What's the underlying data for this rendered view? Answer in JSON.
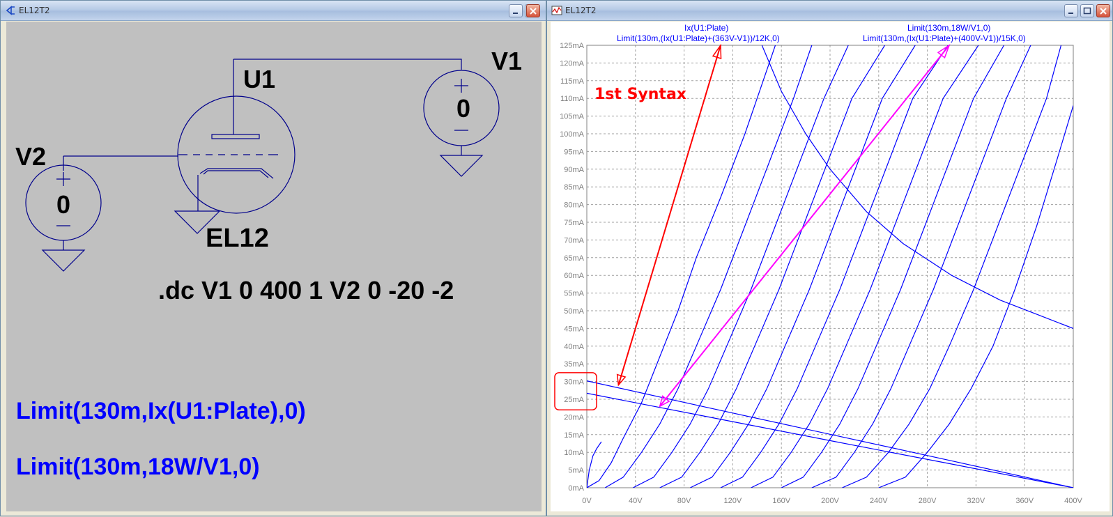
{
  "schematic_window": {
    "title": "EL12T2",
    "labels": {
      "v1": "V1",
      "v2": "V2",
      "u1": "U1",
      "tube_model": "EL12",
      "v1_value": "0",
      "v2_value": "0",
      "plus": "+",
      "minus": "−"
    },
    "dc_directive": ".dc V1 0 400 1 V2 0 -20 -2",
    "expressions": [
      "Limit(130m,Ix(U1:Plate),0)",
      "Limit(130m,18W/V1,0)"
    ]
  },
  "plot_window": {
    "title": "EL12T2",
    "annotation": "1st Syntax",
    "trace_titles": {
      "left_line1": "Ix(U1:Plate)",
      "left_line2": "Limit(130m,(Ix(U1:Plate)+(363V-V1))/12K,0)",
      "right_line1": "Limit(130m,18W/V1,0)",
      "right_line2": "Limit(130m,(Ix(U1:Plate)+(400V-V1))/15K,0)"
    },
    "colors": {
      "trace": "#0000ff",
      "annotation": "#ff0000",
      "highlight": "#ff00ff",
      "grid": "#a0a0a0",
      "axis_text": "#808080"
    }
  },
  "chart_data": {
    "type": "line",
    "xlabel": "",
    "ylabel": "",
    "xlim": [
      0,
      400
    ],
    "ylim": [
      0,
      125
    ],
    "x_ticks": [
      "0V",
      "40V",
      "80V",
      "120V",
      "160V",
      "200V",
      "240V",
      "280V",
      "320V",
      "360V",
      "400V"
    ],
    "y_ticks": [
      "0mA",
      "5mA",
      "10mA",
      "15mA",
      "20mA",
      "25mA",
      "30mA",
      "35mA",
      "40mA",
      "45mA",
      "50mA",
      "55mA",
      "60mA",
      "65mA",
      "70mA",
      "75mA",
      "80mA",
      "85mA",
      "90mA",
      "95mA",
      "100mA",
      "105mA",
      "110mA",
      "115mA",
      "120mA",
      "125mA"
    ],
    "grid": true,
    "series": [
      {
        "x": [
          0,
          2,
          5,
          8,
          12
        ],
        "y": [
          0,
          5,
          9,
          11,
          13
        ]
      },
      {
        "x": [
          0,
          10,
          20,
          30,
          45,
          60,
          75,
          90,
          110,
          130,
          155
        ],
        "y": [
          0,
          2,
          7,
          14,
          24,
          37,
          50,
          65,
          82,
          100,
          125
        ]
      },
      {
        "x": [
          15,
          30,
          45,
          60,
          75,
          90,
          110,
          130,
          150,
          170,
          185
        ],
        "y": [
          0,
          3,
          10,
          18,
          28,
          40,
          56,
          74,
          92,
          110,
          125
        ]
      },
      {
        "x": [
          38,
          55,
          70,
          85,
          100,
          115,
          135,
          155,
          175,
          195,
          215
        ],
        "y": [
          0,
          3,
          10,
          18,
          28,
          40,
          56,
          74,
          92,
          110,
          125
        ]
      },
      {
        "x": [
          60,
          78,
          93,
          108,
          123,
          138,
          158,
          178,
          198,
          218,
          245
        ],
        "y": [
          0,
          3,
          10,
          18,
          28,
          40,
          56,
          74,
          92,
          110,
          125
        ]
      },
      {
        "x": [
          85,
          103,
          118,
          133,
          148,
          163,
          183,
          203,
          223,
          243,
          270
        ],
        "y": [
          0,
          3,
          10,
          18,
          28,
          40,
          56,
          74,
          92,
          110,
          125
        ]
      },
      {
        "x": [
          110,
          128,
          143,
          158,
          173,
          188,
          208,
          228,
          248,
          268,
          297
        ],
        "y": [
          0,
          3,
          10,
          18,
          28,
          40,
          56,
          74,
          92,
          110,
          125
        ]
      },
      {
        "x": [
          135,
          153,
          168,
          183,
          198,
          213,
          233,
          253,
          273,
          293,
          322
        ],
        "y": [
          0,
          3,
          10,
          18,
          28,
          40,
          56,
          74,
          92,
          110,
          125
        ]
      },
      {
        "x": [
          160,
          178,
          193,
          208,
          223,
          238,
          258,
          278,
          298,
          318,
          343
        ],
        "y": [
          0,
          3,
          10,
          18,
          28,
          40,
          56,
          74,
          92,
          110,
          125
        ]
      },
      {
        "x": [
          185,
          205,
          220,
          235,
          250,
          265,
          285,
          305,
          325,
          345,
          365
        ],
        "y": [
          0,
          3,
          10,
          18,
          28,
          40,
          56,
          74,
          92,
          110,
          125
        ]
      },
      {
        "x": [
          210,
          230,
          248,
          265,
          282,
          298,
          318,
          338,
          358,
          378,
          390
        ],
        "y": [
          0,
          3,
          10,
          18,
          28,
          40,
          56,
          74,
          92,
          110,
          125
        ]
      },
      {
        "x": [
          240,
          262,
          280,
          298,
          316,
          334,
          352,
          370,
          386,
          400
        ],
        "y": [
          0,
          3,
          10,
          18,
          28,
          40,
          56,
          74,
          92,
          108
        ]
      },
      {
        "x": [
          144,
          160,
          180,
          200,
          230,
          260,
          300,
          340,
          370,
          400
        ],
        "y": [
          125,
          112,
          100,
          90,
          78,
          69,
          60,
          53,
          49,
          45
        ]
      },
      {
        "x": [
          0,
          100,
          200,
          300,
          400
        ],
        "y": [
          30.2,
          22.6,
          15.1,
          7.6,
          0
        ]
      },
      {
        "x": [
          0,
          100,
          200,
          300,
          400
        ],
        "y": [
          26.7,
          20,
          13.3,
          6.7,
          0
        ]
      }
    ],
    "annotation_arrows": [
      {
        "color": "#ff0000",
        "x": [
          26,
          110
        ],
        "y": [
          29,
          125
        ]
      },
      {
        "color": "#ff00ff",
        "x": [
          60,
          298
        ],
        "y": [
          23,
          125
        ]
      }
    ]
  }
}
